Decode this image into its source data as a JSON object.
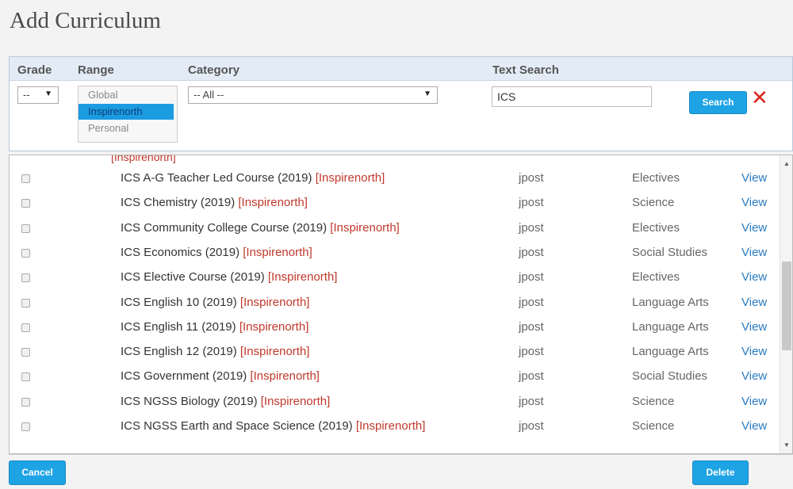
{
  "title": "Add Curriculum",
  "filters": {
    "grade_label": "Grade",
    "range_label": "Range",
    "category_label": "Category",
    "text_search_label": "Text Search",
    "grade_value": "--",
    "category_value": "-- All --",
    "search_value": "ICS",
    "range_options": [
      "Global",
      "Inspirenorth",
      "Personal"
    ],
    "range_selected": "Inspirenorth",
    "search_button": "Search"
  },
  "results": {
    "cut_text": "[Inspirenorth]",
    "rows": [
      {
        "name": "ICS A-G Teacher Led Course (2019)",
        "tag": "[Inspirenorth]",
        "owner": "jpost",
        "subject": "Electives",
        "action": "View"
      },
      {
        "name": "ICS Chemistry (2019)",
        "tag": "[Inspirenorth]",
        "owner": "jpost",
        "subject": "Science",
        "action": "View"
      },
      {
        "name": "ICS Community College Course (2019)",
        "tag": "[Inspirenorth]",
        "owner": "jpost",
        "subject": "Electives",
        "action": "View"
      },
      {
        "name": "ICS Economics (2019)",
        "tag": "[Inspirenorth]",
        "owner": "jpost",
        "subject": "Social Studies",
        "action": "View"
      },
      {
        "name": "ICS Elective Course (2019)",
        "tag": "[Inspirenorth]",
        "owner": "jpost",
        "subject": "Electives",
        "action": "View"
      },
      {
        "name": "ICS English 10 (2019)",
        "tag": "[Inspirenorth]",
        "owner": "jpost",
        "subject": "Language Arts",
        "action": "View"
      },
      {
        "name": "ICS English 11 (2019)",
        "tag": "[Inspirenorth]",
        "owner": "jpost",
        "subject": "Language Arts",
        "action": "View"
      },
      {
        "name": "ICS English 12 (2019)",
        "tag": "[Inspirenorth]",
        "owner": "jpost",
        "subject": "Language Arts",
        "action": "View"
      },
      {
        "name": "ICS Government (2019)",
        "tag": "[Inspirenorth]",
        "owner": "jpost",
        "subject": "Social Studies",
        "action": "View"
      },
      {
        "name": "ICS NGSS Biology (2019)",
        "tag": "[Inspirenorth]",
        "owner": "jpost",
        "subject": "Science",
        "action": "View"
      },
      {
        "name": "ICS NGSS Earth and Space Science (2019)",
        "tag": "[Inspirenorth]",
        "owner": "jpost",
        "subject": "Science",
        "action": "View"
      }
    ]
  },
  "footer": {
    "cancel_label": "Cancel",
    "delete_label": "Delete"
  },
  "colors": {
    "accent": "#1ea3e5",
    "tag": "#c0392b",
    "link": "#2a7bbf",
    "close": "#d9261c"
  },
  "icons": {
    "close": "close-icon",
    "dropdown": "chevron-down-icon"
  }
}
